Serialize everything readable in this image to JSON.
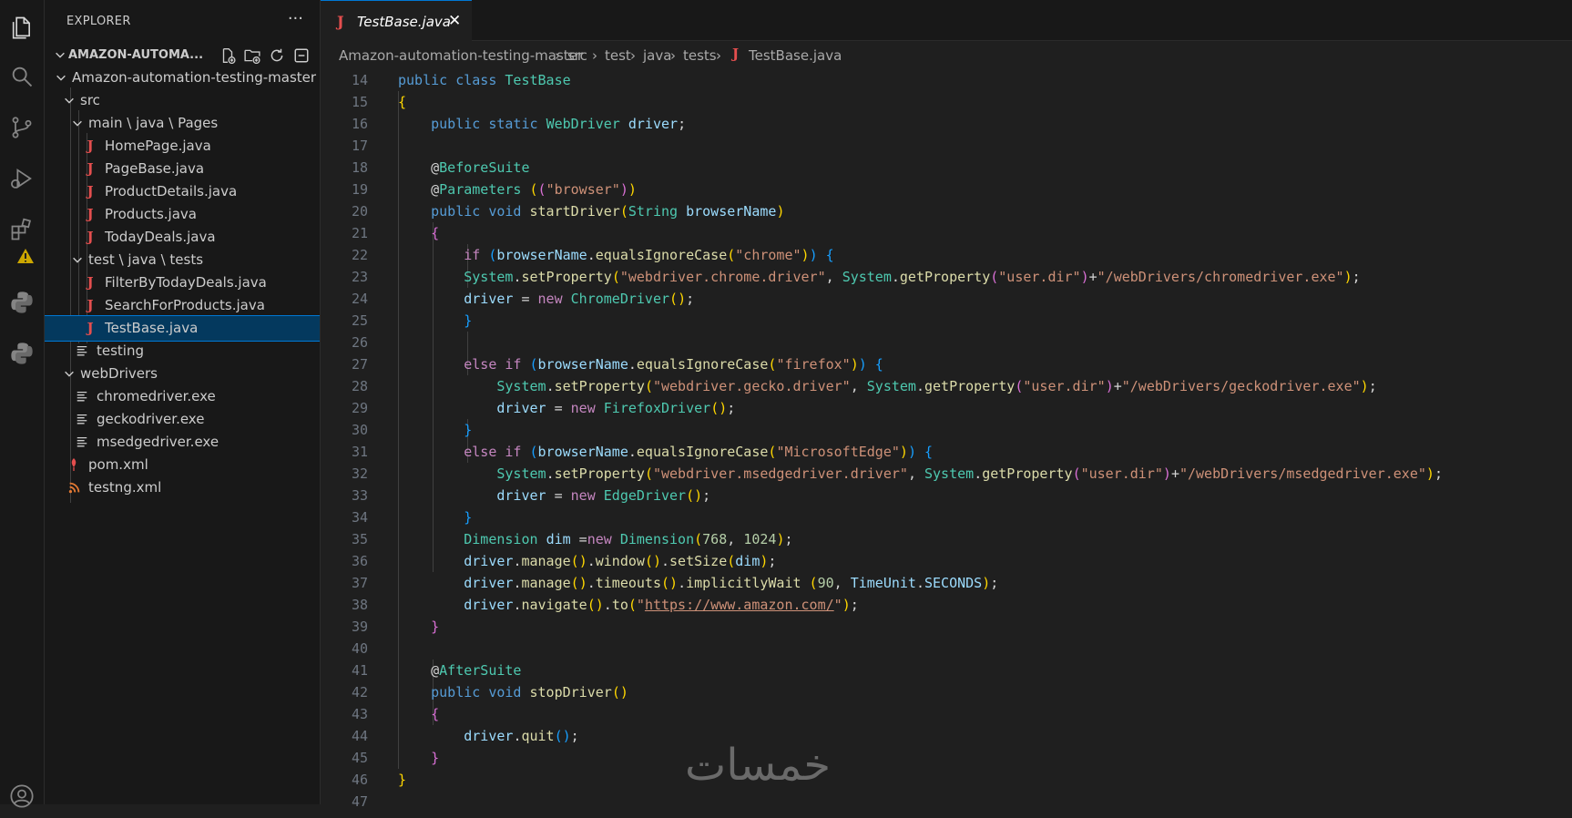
{
  "sidebar": {
    "title": "EXPLORER",
    "more": "···",
    "section": "AMAZON-AUTOMA...",
    "tree": [
      {
        "label": "Amazon-automation-testing-master"
      },
      {
        "label": "src"
      },
      {
        "label": "main \\ java \\ Pages"
      },
      {
        "label": "HomePage.java"
      },
      {
        "label": "PageBase.java"
      },
      {
        "label": "ProductDetails.java"
      },
      {
        "label": "Products.java"
      },
      {
        "label": "TodayDeals.java"
      },
      {
        "label": "test \\ java \\ tests"
      },
      {
        "label": "FilterByTodayDeals.java"
      },
      {
        "label": "SearchForProducts.java"
      },
      {
        "label": "TestBase.java"
      },
      {
        "label": "testing"
      },
      {
        "label": "webDrivers"
      },
      {
        "label": "chromedriver.exe"
      },
      {
        "label": "geckodriver.exe"
      },
      {
        "label": "msedgedriver.exe"
      },
      {
        "label": "pom.xml"
      },
      {
        "label": "testng.xml"
      }
    ]
  },
  "tab": {
    "icon": "J",
    "name": "TestBase.java",
    "close": "✕"
  },
  "breadcrumb": {
    "parts": [
      "Amazon-automation-testing-master",
      "src",
      "test",
      "java",
      "tests"
    ],
    "sep": "›",
    "file_icon": "J",
    "file": "TestBase.java"
  },
  "code": {
    "line_numbers": [
      "14",
      "15",
      "16",
      "17",
      "18",
      "19",
      "20",
      "21",
      "22",
      "23",
      "24",
      "25",
      "26",
      "27",
      "28",
      "29",
      "30",
      "31",
      "32",
      "33",
      "34",
      "35",
      "36",
      "37",
      "38",
      "39",
      "40",
      "41",
      "42",
      "43",
      "44",
      "45",
      "46",
      "47"
    ],
    "l14": [
      "public",
      "class",
      "TestBase"
    ],
    "l15": [
      "{"
    ],
    "l16": [
      "public",
      "static",
      "WebDriver",
      "driver",
      ";"
    ],
    "l18": [
      "@",
      "BeforeSuite"
    ],
    "l19": [
      "@",
      "Parameters",
      " (",
      "(",
      "\"browser\"",
      ")",
      ")"
    ],
    "l20": [
      "public",
      "void",
      "startDriver",
      "(",
      "String",
      "browserName",
      ")"
    ],
    "l21": [
      "{"
    ],
    "l22": [
      "if",
      " (",
      "browserName",
      ".",
      "equalsIgnoreCase",
      "(",
      "\"chrome\"",
      ")",
      ")",
      " {"
    ],
    "l23": [
      "System",
      ".",
      "setProperty",
      "(",
      "\"webdriver.chrome.driver\"",
      ", ",
      "System",
      ".",
      "getProperty",
      "(",
      "\"user.dir\"",
      ")",
      "+",
      "\"/webDrivers/chromedriver.exe\"",
      ")",
      ";"
    ],
    "l24": [
      "driver",
      " = ",
      "new",
      "ChromeDriver",
      "(",
      ")",
      ";"
    ],
    "l25": [
      "}"
    ],
    "l27": [
      "else",
      "if",
      " (",
      "browserName",
      ".",
      "equalsIgnoreCase",
      "(",
      "\"firefox\"",
      ")",
      ")",
      " {"
    ],
    "l28": [
      "System",
      ".",
      "setProperty",
      "(",
      "\"webdriver.gecko.driver\"",
      ", ",
      "System",
      ".",
      "getProperty",
      "(",
      "\"user.dir\"",
      ")",
      "+",
      "\"/webDrivers/geckodriver.exe\"",
      ")",
      ";"
    ],
    "l29": [
      "driver",
      " = ",
      "new",
      "FirefoxDriver",
      "(",
      ")",
      ";"
    ],
    "l30": [
      "}"
    ],
    "l31": [
      "else",
      "if",
      " (",
      "browserName",
      ".",
      "equalsIgnoreCase",
      "(",
      "\"MicrosoftEdge\"",
      ")",
      ")",
      " {"
    ],
    "l32": [
      "System",
      ".",
      "setProperty",
      "(",
      "\"webdriver.msedgedriver.driver\"",
      ", ",
      "System",
      ".",
      "getProperty",
      "(",
      "\"user.dir\"",
      ")",
      "+",
      "\"/webDrivers/msedgedriver.exe\"",
      ")",
      ";"
    ],
    "l33": [
      "driver",
      " = ",
      "new",
      "EdgeDriver",
      "(",
      ")",
      ";"
    ],
    "l34": [
      "}"
    ],
    "l35": [
      "Dimension",
      "dim",
      " =",
      "new",
      "Dimension",
      "(",
      "768",
      ", ",
      "1024",
      ")",
      ";"
    ],
    "l36": [
      "driver",
      ".",
      "manage",
      "(",
      ")",
      ".",
      "window",
      "(",
      ")",
      ".",
      "setSize",
      "(",
      "dim",
      ")",
      ";"
    ],
    "l37": [
      "driver",
      ".",
      "manage",
      "(",
      ")",
      ".",
      "timeouts",
      "(",
      ")",
      ".",
      "implicitlyWait",
      " (",
      "90",
      ", ",
      "TimeUnit",
      ".",
      "SECONDS",
      ")",
      ";"
    ],
    "l38": [
      "driver",
      ".",
      "navigate",
      "(",
      ")",
      ".",
      "to",
      "(",
      "\"",
      "https://www.amazon.com/",
      "\"",
      ")",
      ";"
    ],
    "l39": [
      "}"
    ],
    "l41": [
      "@",
      "AfterSuite"
    ],
    "l42": [
      "public",
      "void",
      "stopDriver",
      "(",
      ")"
    ],
    "l43": [
      "{"
    ],
    "l44": [
      "driver",
      ".",
      "quit",
      "(",
      ")",
      ";"
    ],
    "l45": [
      "}"
    ],
    "l46": [
      "}"
    ]
  },
  "watermark": "خمسات",
  "colors": {
    "accent": "#0078d4",
    "selection": "#04395e",
    "java_icon": "#e44e4e",
    "warning": "#cca700"
  }
}
